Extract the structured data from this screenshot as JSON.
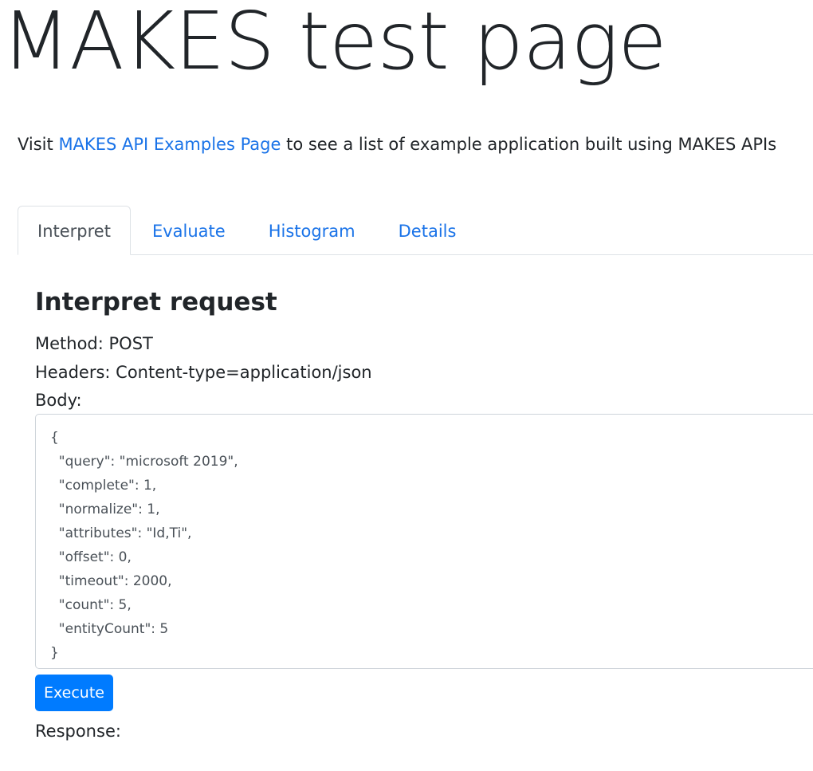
{
  "page": {
    "title": "MAKES test page"
  },
  "intro": {
    "prefix": "Visit ",
    "link_text": "MAKES API Examples Page",
    "suffix": " to see a list of example application built using MAKES APIs"
  },
  "tabs": [
    {
      "label": "Interpret",
      "active": true
    },
    {
      "label": "Evaluate",
      "active": false
    },
    {
      "label": "Histogram",
      "active": false
    },
    {
      "label": "Details",
      "active": false
    }
  ],
  "request": {
    "heading": "Interpret request",
    "method_line": "Method: POST",
    "headers_line": "Headers: Content-type=application/json",
    "body_label": "Body:",
    "body_value": "{\n  \"query\": \"microsoft 2019\",\n  \"complete\": 1,\n  \"normalize\": 1,\n  \"attributes\": \"Id,Ti\",\n  \"offset\": 0,\n  \"timeout\": 2000,\n  \"count\": 5,\n  \"entityCount\": 5\n}",
    "execute_label": "Execute",
    "response_label": "Response:"
  },
  "colors": {
    "link": "#1a73e8",
    "primary_button": "#007bff",
    "text": "#212529"
  }
}
